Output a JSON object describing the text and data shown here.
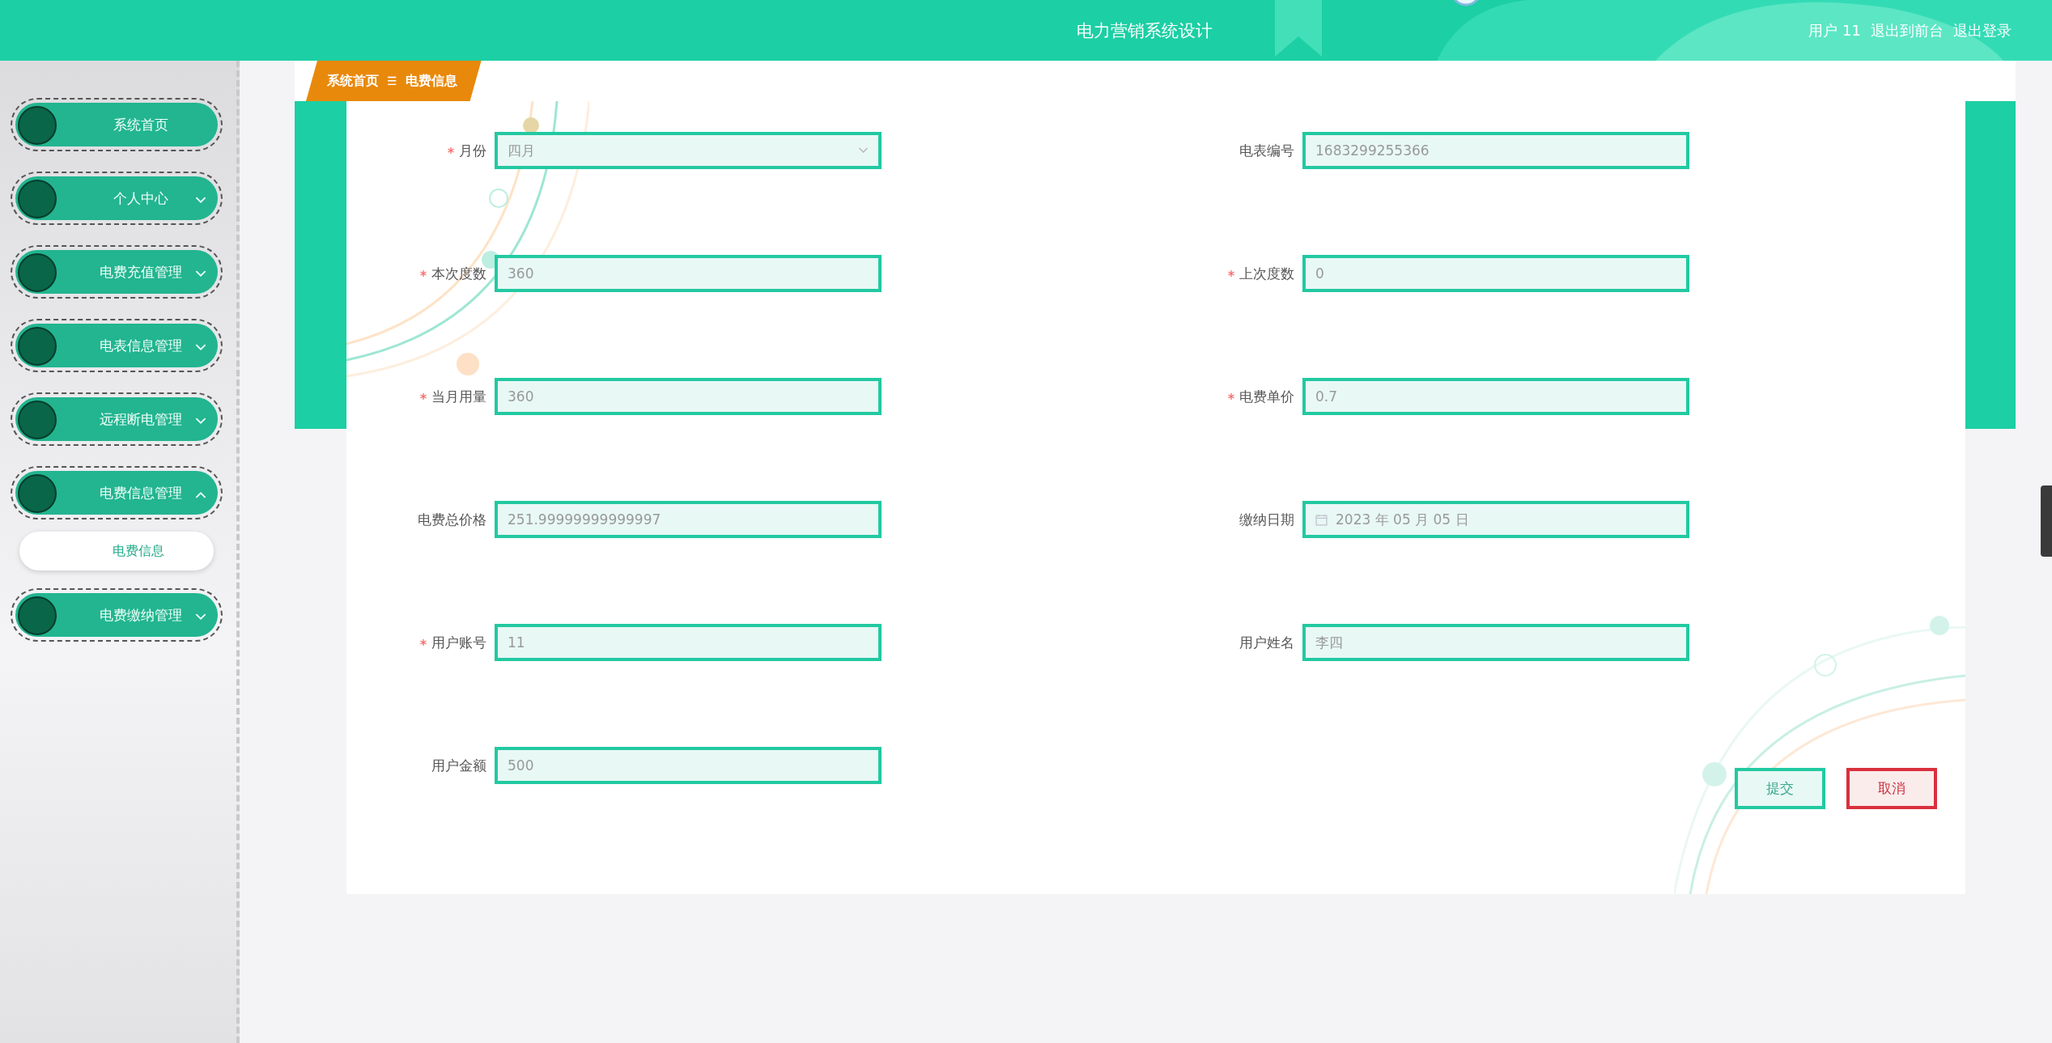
{
  "header": {
    "title": "电力营销系统设计",
    "user_links": [
      "用户 11",
      "退出到前台",
      "退出登录"
    ]
  },
  "sidebar": {
    "items": [
      {
        "label": "系统首页",
        "kind": "link"
      },
      {
        "label": "个人中心",
        "kind": "menu",
        "expanded": false
      },
      {
        "label": "电费充值管理",
        "kind": "menu",
        "expanded": false
      },
      {
        "label": "电表信息管理",
        "kind": "menu",
        "expanded": false
      },
      {
        "label": "远程断电管理",
        "kind": "menu",
        "expanded": false
      },
      {
        "label": "电费信息管理",
        "kind": "menu",
        "expanded": true,
        "children": [
          {
            "label": "电费信息",
            "selected": true
          }
        ]
      },
      {
        "label": "电费缴纳管理",
        "kind": "menu",
        "expanded": false
      }
    ]
  },
  "breadcrumb": {
    "items": [
      "系统首页",
      "电费信息"
    ],
    "separator": "☰"
  },
  "form": {
    "fields": [
      {
        "label": "月份",
        "required": true,
        "kind": "select",
        "value": "四月"
      },
      {
        "label": "电表编号",
        "required": false,
        "kind": "text",
        "value": "1683299255366"
      },
      {
        "label": "本次度数",
        "required": true,
        "kind": "text",
        "value": "360"
      },
      {
        "label": "上次度数",
        "required": true,
        "kind": "text",
        "value": "0"
      },
      {
        "label": "当月用量",
        "required": true,
        "kind": "text",
        "value": "360"
      },
      {
        "label": "电费单价",
        "required": true,
        "kind": "text",
        "value": "0.7"
      },
      {
        "label": "电费总价格",
        "required": false,
        "kind": "text",
        "value": "251.99999999999997"
      },
      {
        "label": "缴纳日期",
        "required": false,
        "kind": "date",
        "value": "2023 年 05 月 05 日"
      },
      {
        "label": "用户账号",
        "required": true,
        "kind": "text",
        "value": "11"
      },
      {
        "label": "用户姓名",
        "required": false,
        "kind": "text",
        "value": "李四"
      },
      {
        "label": "用户金额",
        "required": false,
        "kind": "text",
        "value": "500"
      }
    ],
    "buttons": [
      {
        "label": "提交",
        "kind": "primary"
      },
      {
        "label": "取消",
        "kind": "danger"
      }
    ]
  }
}
